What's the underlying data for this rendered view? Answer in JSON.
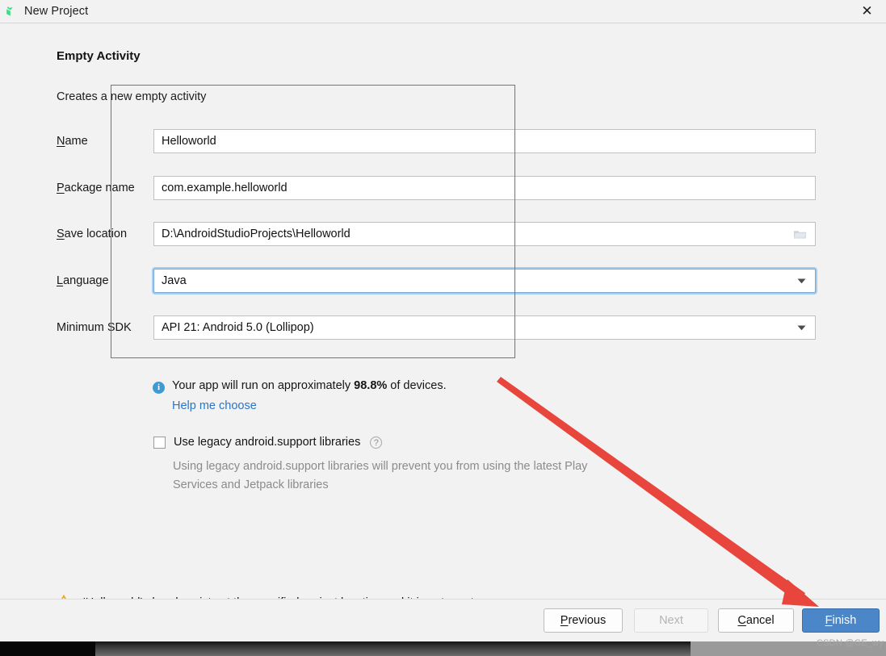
{
  "window": {
    "title": "New Project",
    "icon": "android-icon",
    "close_label": "✕"
  },
  "page": {
    "title": "Empty Activity",
    "description": "Creates a new empty activity"
  },
  "form": {
    "rows": [
      {
        "label_mnemonic": "N",
        "label_rest": "ame",
        "name": "name",
        "value": "Helloworld",
        "type": "text"
      },
      {
        "label_mnemonic": "P",
        "label_rest": "ackage name",
        "name": "package-name",
        "value": "com.example.helloworld",
        "type": "text"
      },
      {
        "label_mnemonic": "S",
        "label_rest": "ave location",
        "name": "save-location",
        "value": "D:\\AndroidStudioProjects\\Helloworld",
        "type": "text-browse"
      },
      {
        "label_mnemonic": "L",
        "label_rest": "anguage",
        "name": "language",
        "value": "Java",
        "type": "dropdown",
        "focused": true
      },
      {
        "label_mnemonic": "",
        "label_rest": "Minimum SDK",
        "name": "minimum-sdk",
        "value": "API 21: Android 5.0 (Lollipop)",
        "type": "dropdown"
      }
    ]
  },
  "info": {
    "icon_glyph": "i",
    "prefix": "Your app will run on approximately ",
    "percent": "98.8%",
    "suffix": " of devices.",
    "help_link": "Help me choose"
  },
  "legacy": {
    "checkbox_label": "Use legacy android.support libraries",
    "checked": false,
    "help_glyph": "?",
    "description": "Using legacy android.support libraries will prevent you from using the latest Play Services and Jetpack libraries"
  },
  "warning": {
    "icon": "warning-triangle-icon",
    "message": "'Helloworld' already exists at the specified project location and it is not empty."
  },
  "footer": {
    "buttons": [
      {
        "name": "previous",
        "mnemonic": "P",
        "rest": "revious",
        "state": "enabled"
      },
      {
        "name": "next",
        "mnemonic": "",
        "rest": "Next",
        "state": "disabled"
      },
      {
        "name": "cancel",
        "mnemonic": "C",
        "rest": "ancel",
        "state": "enabled"
      },
      {
        "name": "finish",
        "mnemonic": "F",
        "rest": "inish",
        "state": "primary"
      }
    ]
  },
  "watermark": "CSDN @GE_wy",
  "colors": {
    "accent_blue": "#4a86c8",
    "link_blue": "#2a76c4",
    "info_blue": "#3d9ad4",
    "warning_amber": "#f0a818",
    "annotation_red": "#e8453c",
    "focus_ring": "#a9cdee",
    "android_green": "#3ddc84"
  }
}
